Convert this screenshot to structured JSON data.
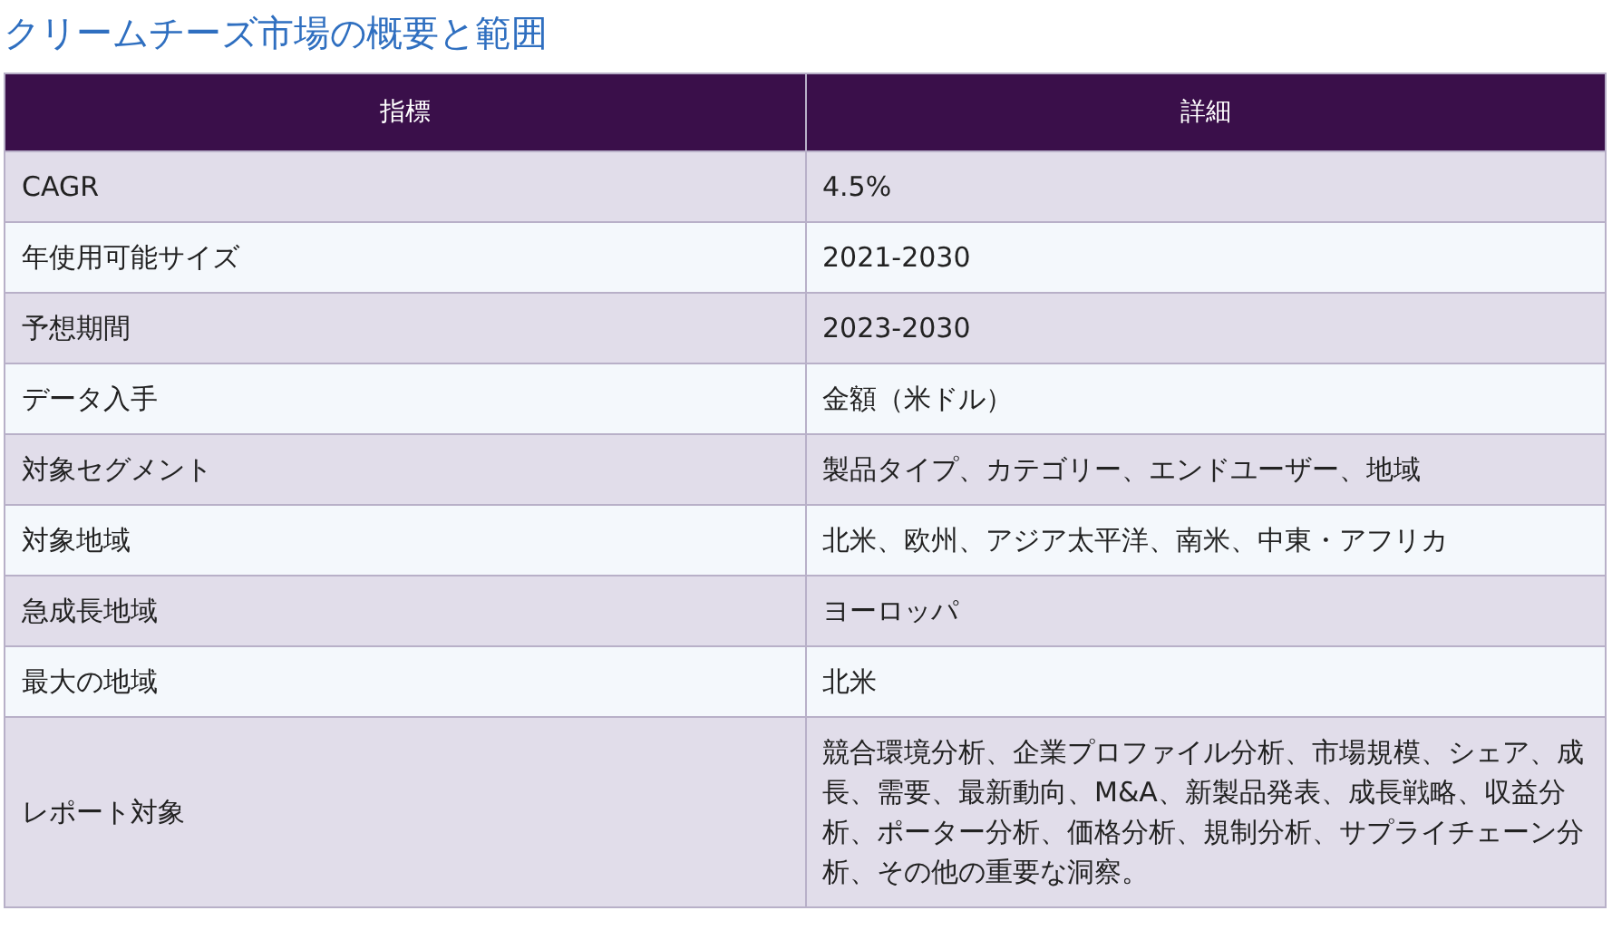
{
  "title": "クリームチーズ市場の概要と範囲",
  "table": {
    "columns": [
      "指標",
      "詳細"
    ],
    "rows": [
      [
        "CAGR",
        "4.5%"
      ],
      [
        "年使用可能サイズ",
        "2021-2030"
      ],
      [
        "予想期間",
        "2023-2030"
      ],
      [
        "データ入手",
        "金額（米ドル）"
      ],
      [
        "対象セグメント",
        "製品タイプ、カテゴリー、エンドユーザー、地域"
      ],
      [
        "対象地域",
        "北米、欧州、アジア太平洋、南米、中東・アフリカ"
      ],
      [
        "急成長地域",
        "ヨーロッパ"
      ],
      [
        "最大の地域",
        "北米"
      ],
      [
        "レポート対象",
        "競合環境分析、企業プロファイル分析、市場規模、シェア、成長、需要、最新動向、M&A、新製品発表、成長戦略、収益分析、ポーター分析、価格分析、規制分析、サプライチェーン分析、その他の重要な洞察。"
      ]
    ]
  }
}
